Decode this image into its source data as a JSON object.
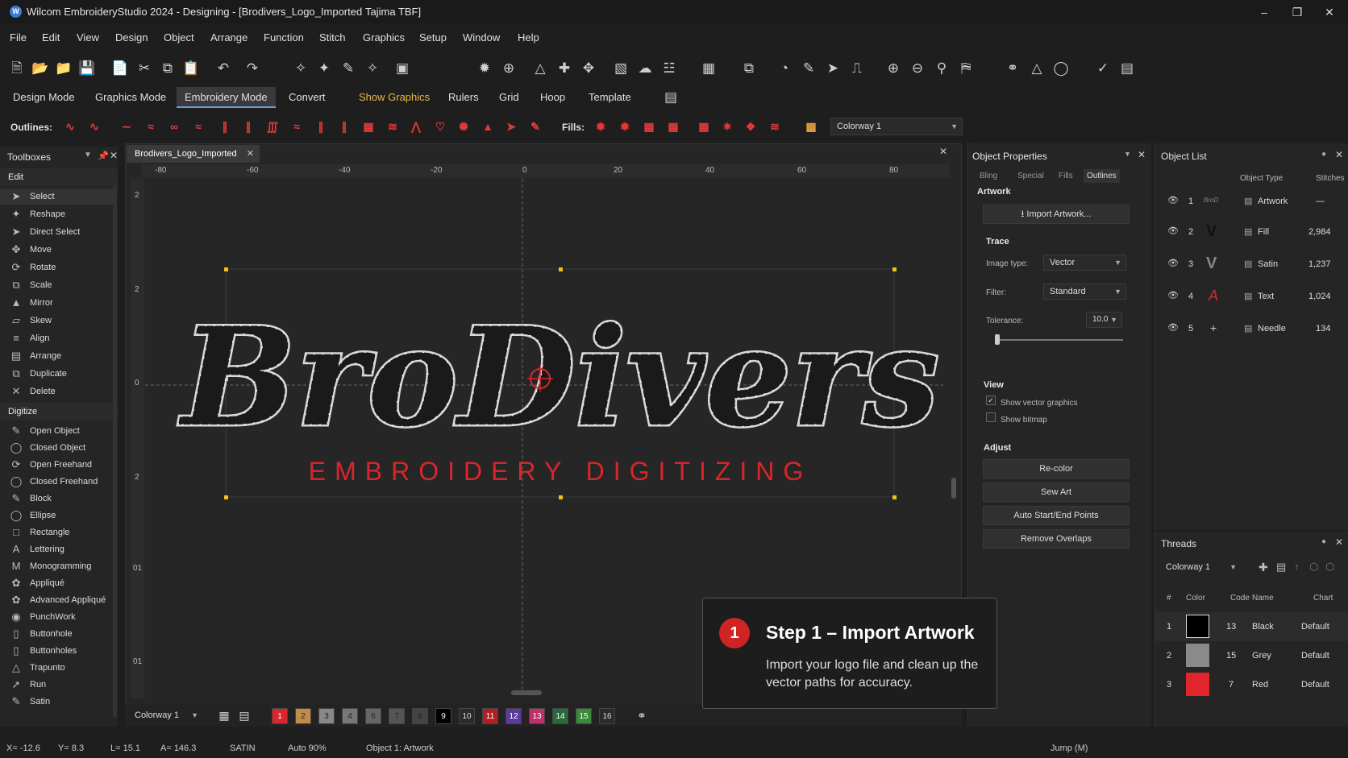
{
  "titlebar": {
    "title": "Wilcom EmbroideryStudio 2024 - Designing - [Brodivers_Logo_Imported",
    "machine": "Tajima  TBF]"
  },
  "menu": [
    "File",
    "Edit",
    "View",
    "Design",
    "Object",
    "Arrange",
    "Function",
    "Stitch",
    "Graphics",
    "Setup",
    "Window",
    "Help"
  ],
  "modes": [
    "Design Mode",
    "Graphics Mode",
    "Embroidery Mode",
    "Convert",
    "Show Graphics",
    "Rulers",
    "Grid",
    "Hoop",
    "Template"
  ],
  "stitchbar": {
    "outlines_label": "Outlines:",
    "fills_label": "Fills:",
    "colorway": "Colorway 1"
  },
  "toolbox": {
    "title": "Toolboxes",
    "edit_header": "Edit",
    "edit_items": [
      "Select",
      "Reshape",
      "Direct Select",
      "Move",
      "Rotate",
      "Scale",
      "Mirror",
      "Skew",
      "Align",
      "Arrange",
      "Duplicate",
      "Delete"
    ],
    "digitize_header": "Digitize",
    "digitize_items": [
      "Open Object",
      "Closed Object",
      "Open Freehand",
      "Closed Freehand",
      "Block",
      "Ellipse",
      "Rectangle",
      "Lettering",
      "Monogramming",
      "Appliqué",
      "Advanced Appliqué",
      "PunchWork",
      "Buttonhole",
      "Buttonholes",
      "Trapunto",
      "Run",
      "Satin"
    ]
  },
  "document": {
    "tab": "Brodivers_Logo_Imported"
  },
  "ruler": {
    "h": [
      "-80",
      "-60",
      "-40",
      "-20",
      "0",
      "20",
      "40",
      "60",
      "80"
    ],
    "v": [
      "2",
      "2",
      "0",
      "2",
      "01",
      "01"
    ]
  },
  "design": {
    "logo": "BroDivers",
    "tagline": "EMBROIDERY DIGITIZING"
  },
  "canvas_bottom": {
    "colorway": "Colorway 1",
    "swatches": [
      "1",
      "2",
      "3",
      "4",
      "6",
      "7",
      "8",
      "9",
      "10",
      "11",
      "12",
      "13",
      "14",
      "15",
      "16"
    ]
  },
  "properties": {
    "title": "Object Properties",
    "tabs": [
      "Bling",
      "Special",
      "Fills",
      "Outlines"
    ],
    "artwork_label": "Artwork",
    "import_btn": "Import Artwork...",
    "trace_label": "Trace",
    "image_type_label": "Image type:",
    "image_type": "Vector",
    "filter_label": "Filter:",
    "filter": "Standard",
    "tolerance_label": "Tolerance:",
    "tolerance": "10.0",
    "view_label": "View",
    "show_vector": "Show vector graphics",
    "show_bitmap": "Show bitmap",
    "adjust_label": "Adjust",
    "buttons": [
      "Re-color",
      "Sew Art",
      "Auto Start/End Points",
      "Remove Overlaps"
    ]
  },
  "object_list": {
    "title": "Object List",
    "col_type": "Object Type",
    "col_stitches": "Stitches",
    "rows": [
      {
        "n": "1",
        "type": "Artwork",
        "stitches": "—"
      },
      {
        "n": "2",
        "type": "Fill",
        "stitches": "2,984"
      },
      {
        "n": "3",
        "type": "Satin",
        "stitches": "1,237"
      },
      {
        "n": "4",
        "type": "Text",
        "stitches": "1,024"
      },
      {
        "n": "5",
        "type": "Needle",
        "stitches": "134"
      }
    ]
  },
  "threads": {
    "title": "Threads",
    "colorway": "Colorway 1",
    "cols": [
      "#",
      "Color",
      "Code",
      "Name",
      "Chart"
    ],
    "rows": [
      {
        "n": "1",
        "color": "#000000",
        "code": "13",
        "name": "Black",
        "chart": "Default"
      },
      {
        "n": "2",
        "color": "#8a8a8a",
        "code": "15",
        "name": "Grey",
        "chart": "Default"
      },
      {
        "n": "3",
        "color": "#e0262c",
        "code": "7",
        "name": "Red",
        "chart": "Default"
      }
    ]
  },
  "callout": {
    "number": "1",
    "heading": "Step 1 – Import Artwork",
    "body": "Import your logo file and clean up the vector paths for accuracy."
  },
  "status": {
    "x": "X= -12.6",
    "y": "Y= 8.3",
    "l": "L= 15.1",
    "a": "A= 146.3",
    "type": "SATIN",
    "auto": "Auto  90%",
    "object": "Object 1: Artwork",
    "jump": "Jump (M)"
  },
  "colors": {
    "accent_red": "#d02424",
    "active_mode": "#3a3a3a"
  }
}
